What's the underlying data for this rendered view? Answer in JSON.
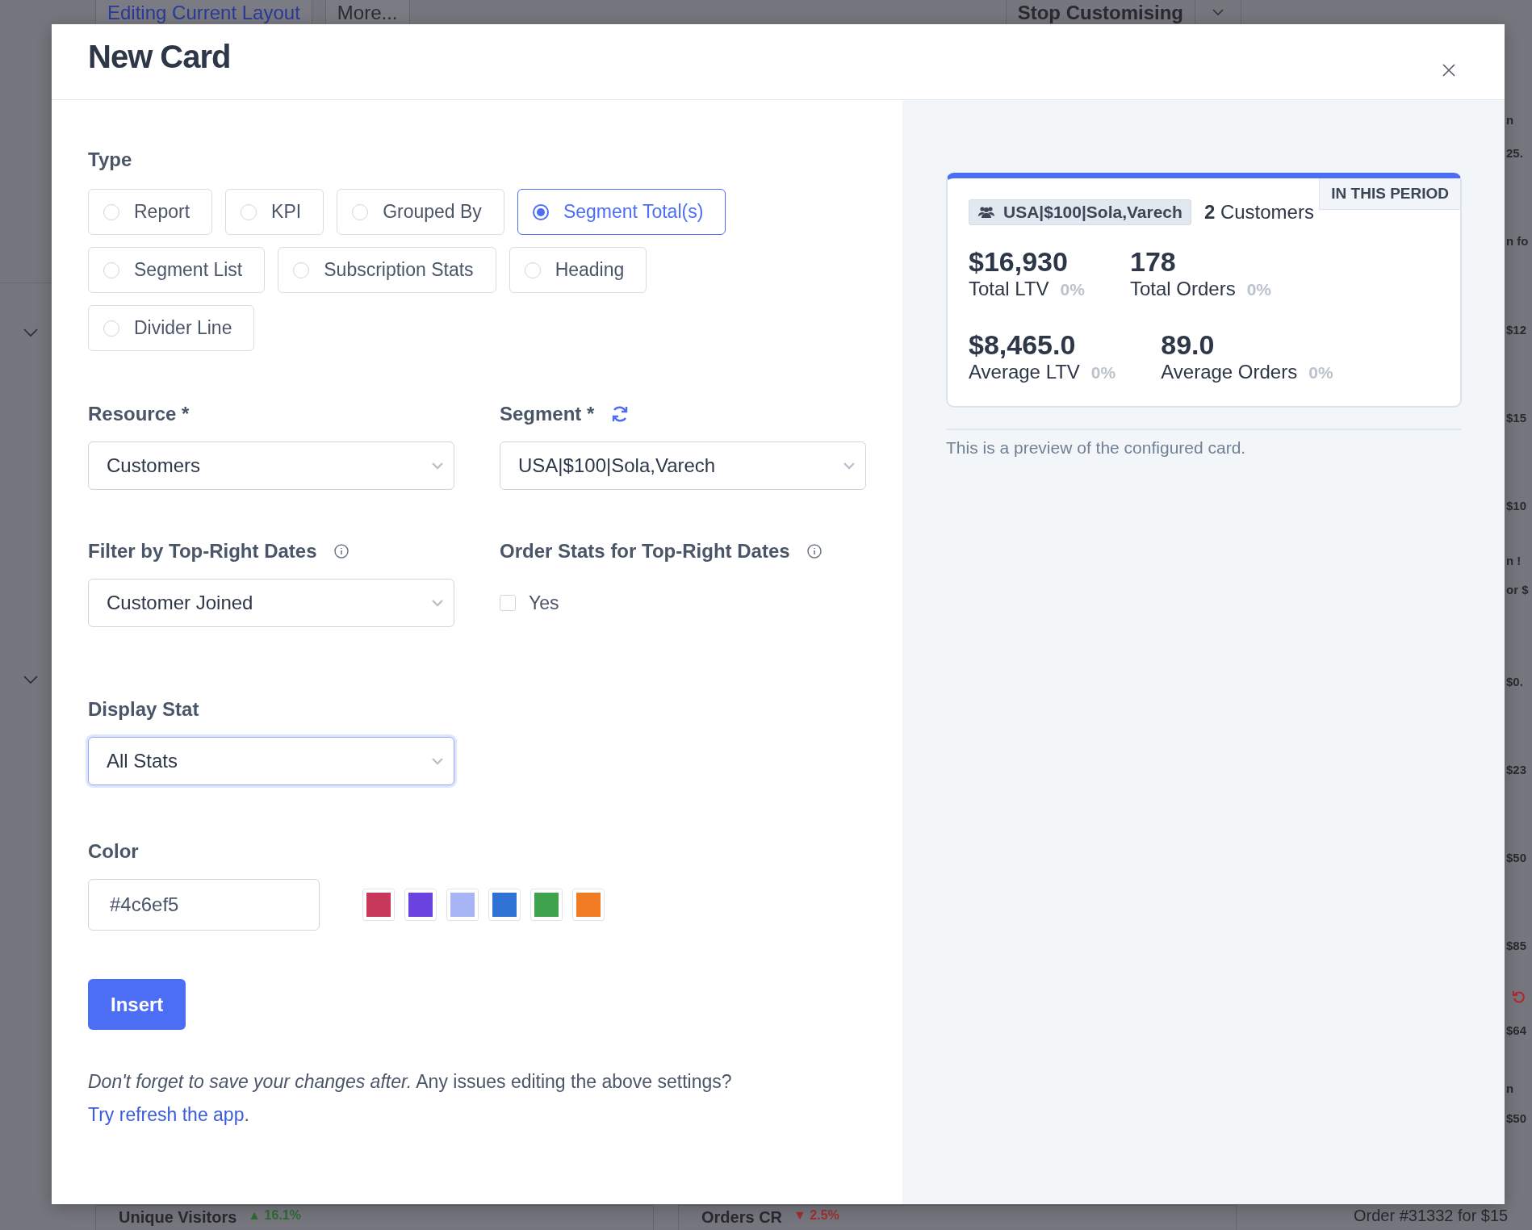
{
  "background": {
    "top_tabs": [
      {
        "label": "Editing Current Layout",
        "selected": true
      },
      {
        "label": "More...",
        "selected": false
      }
    ],
    "stop_button": "Stop Customising",
    "right_fragments": [
      {
        "text": "n"
      },
      {
        "text": "25."
      },
      {
        "text": "n fo"
      },
      {
        "text": "$12"
      },
      {
        "text": "$15"
      },
      {
        "text": "$10"
      },
      {
        "text": "n !"
      },
      {
        "text": "or $"
      },
      {
        "text": "$0."
      },
      {
        "text": "$23"
      },
      {
        "text": "$50"
      },
      {
        "text": "$85"
      },
      {
        "text": "$64"
      },
      {
        "text": "n"
      },
      {
        "text": "$50"
      }
    ],
    "bottom_cards": [
      {
        "title": "Unique Visitors",
        "change": "▲ 16.1%",
        "kind": "up"
      },
      {
        "title": "Orders CR",
        "change": "▼ 2.5%",
        "kind": "down"
      }
    ],
    "bottom_order": "Order #31332 for $15"
  },
  "modal": {
    "title": "New Card",
    "type": {
      "label": "Type",
      "options": [
        {
          "label": "Report",
          "selected": false
        },
        {
          "label": "KPI",
          "selected": false
        },
        {
          "label": "Grouped By",
          "selected": false
        },
        {
          "label": "Segment Total(s)",
          "selected": true
        },
        {
          "label": "Segment List",
          "selected": false
        },
        {
          "label": "Subscription Stats",
          "selected": false
        },
        {
          "label": "Heading",
          "selected": false
        },
        {
          "label": "Divider Line",
          "selected": false
        }
      ]
    },
    "resource": {
      "label": "Resource *",
      "value": "Customers"
    },
    "segment": {
      "label": "Segment *",
      "value": "USA|$100|Sola,Varech"
    },
    "filter_dates": {
      "label": "Filter by Top-Right Dates",
      "value": "Customer Joined"
    },
    "order_stats": {
      "label": "Order Stats for Top-Right Dates",
      "option": "Yes",
      "checked": false
    },
    "display_stat": {
      "label": "Display Stat",
      "value": "All Stats",
      "focused": true
    },
    "color": {
      "label": "Color",
      "value": "#4c6ef5",
      "swatches": [
        {
          "color": "#c8385a"
        },
        {
          "color": "#6a42e0"
        },
        {
          "color": "#a7b4f5"
        },
        {
          "color": "#2f73d4"
        },
        {
          "color": "#3fa34d"
        },
        {
          "color": "#f07b22"
        }
      ]
    },
    "insert_button": "Insert",
    "footer": {
      "text": "*Don't forget to save your changes after.* Any issues editing the above settings?",
      "link": "Try refresh the app",
      "end": "."
    },
    "preview": {
      "badge": "IN THIS PERIOD",
      "segment": "USA|$100|Sola,Varech",
      "count": "**2** Customers",
      "stats": [
        {
          "value": "$16,930",
          "label": "Total LTV",
          "change": "0%"
        },
        {
          "value": "178",
          "label": "Total Orders",
          "change": "0%"
        },
        {
          "value": "$8,465.0",
          "label": "Average LTV",
          "change": "0%"
        },
        {
          "value": "89.0",
          "label": "Average Orders",
          "change": "0%"
        }
      ],
      "note": "This is a preview of the configured card."
    }
  }
}
